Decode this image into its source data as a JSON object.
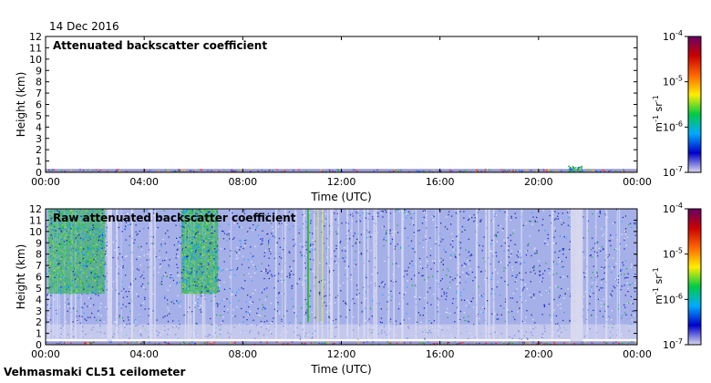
{
  "date": "14 Dec 2016",
  "instrument": "Vehmasmaki CL51 ceilometer",
  "colorbar": {
    "ticks": [
      "10-7",
      "10-6",
      "10-5",
      "10-4"
    ],
    "unit": "m-1 sr-1",
    "colors": [
      "#d8d8f0",
      "#0000cc",
      "#00aaff",
      "#00cc44",
      "#ffee00",
      "#ff6600",
      "#cc0000",
      "#660066"
    ]
  },
  "chart_data": [
    {
      "type": "heatmap",
      "title": "Attenuated backscatter coefficient",
      "xlabel": "Time (UTC)",
      "ylabel": "Height (km)",
      "x_ticks": [
        "00:00",
        "04:00",
        "08:00",
        "12:00",
        "16:00",
        "20:00",
        "00:00"
      ],
      "y_ticks": [
        "0",
        "1",
        "2",
        "3",
        "4",
        "5",
        "6",
        "7",
        "8",
        "9",
        "10",
        "11",
        "12"
      ],
      "ylim": [
        0,
        12
      ],
      "xlim_hours": [
        0,
        24
      ],
      "features": [
        {
          "name": "surface layer",
          "x_start_h": 0,
          "x_end_h": 24,
          "top_km": 0.3
        },
        {
          "name": "speckle near 21:30",
          "x_start_h": 21.2,
          "x_end_h": 21.8,
          "top_km": 0.6
        }
      ]
    },
    {
      "type": "heatmap",
      "title": "Raw attenuated backscatter coefficient",
      "xlabel": "Time (UTC)",
      "ylabel": "Height (km)",
      "x_ticks": [
        "00:00",
        "04:00",
        "08:00",
        "12:00",
        "16:00",
        "20:00",
        "00:00"
      ],
      "y_ticks": [
        "0",
        "1",
        "2",
        "3",
        "4",
        "5",
        "6",
        "7",
        "8",
        "9",
        "10",
        "11",
        "12"
      ],
      "ylim": [
        0,
        12
      ],
      "xlim_hours": [
        0,
        24
      ],
      "features": [
        {
          "name": "noise field",
          "x_start_h": 0,
          "x_end_h": 24,
          "bottom_km": 0.5,
          "top_km": 12
        },
        {
          "name": "green region",
          "x_start_h": 0.1,
          "x_end_h": 2.4,
          "bottom_km": 4.5,
          "top_km": 12
        },
        {
          "name": "green region",
          "x_start_h": 5.5,
          "x_end_h": 7.0,
          "bottom_km": 4.5,
          "top_km": 12
        },
        {
          "name": "green streaks",
          "x_start_h": 10.6,
          "x_end_h": 11.3,
          "bottom_km": 2.0,
          "top_km": 12
        },
        {
          "name": "pale gap",
          "x_start_h": 2.5,
          "x_end_h": 2.7,
          "bottom_km": 0,
          "top_km": 12
        },
        {
          "name": "pale gap",
          "x_start_h": 21.3,
          "x_end_h": 21.8,
          "bottom_km": 0,
          "top_km": 12
        },
        {
          "name": "surface layer",
          "x_start_h": 0,
          "x_end_h": 24,
          "top_km": 0.3
        }
      ]
    }
  ]
}
